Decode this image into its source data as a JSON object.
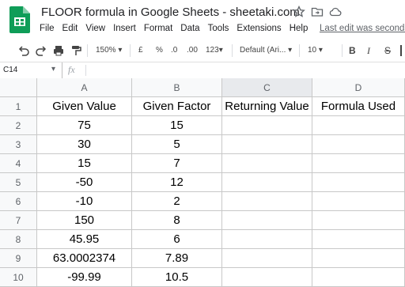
{
  "window": {
    "doc_title": "FLOOR formula in Google Sheets - sheetaki.com",
    "last_edit": "Last edit was seconds"
  },
  "menu": [
    "File",
    "Edit",
    "View",
    "Insert",
    "Format",
    "Data",
    "Tools",
    "Extensions",
    "Help"
  ],
  "toolbar": {
    "zoom": "150%",
    "currency": "£",
    "percent": "%",
    "dec_less": ".0",
    "dec_more": ".00",
    "more_formats": "123",
    "font": "Default (Ari...",
    "font_size": "10",
    "bold": "B",
    "italic": "I",
    "strike": "S"
  },
  "formula_bar": {
    "name_box": "C14",
    "fx": "fx",
    "value": ""
  },
  "sheet": {
    "columns": [
      "A",
      "B",
      "C",
      "D"
    ],
    "selected_column": "C",
    "rows": [
      {
        "n": "1",
        "cells": [
          "Given Value",
          "Given Factor",
          "Returning Value",
          "Formula Used"
        ]
      },
      {
        "n": "2",
        "cells": [
          "75",
          "15",
          "",
          ""
        ]
      },
      {
        "n": "3",
        "cells": [
          "30",
          "5",
          "",
          ""
        ]
      },
      {
        "n": "4",
        "cells": [
          "15",
          "7",
          "",
          ""
        ]
      },
      {
        "n": "5",
        "cells": [
          "-50",
          "12",
          "",
          ""
        ]
      },
      {
        "n": "6",
        "cells": [
          "-10",
          "2",
          "",
          ""
        ]
      },
      {
        "n": "7",
        "cells": [
          "150",
          "8",
          "",
          ""
        ]
      },
      {
        "n": "8",
        "cells": [
          "45.95",
          "6",
          "",
          ""
        ]
      },
      {
        "n": "9",
        "cells": [
          "63.0002374",
          "7.89",
          "",
          ""
        ]
      },
      {
        "n": "10",
        "cells": [
          "-99.99",
          "10.5",
          "",
          ""
        ]
      }
    ]
  },
  "colors": {
    "sheets_green": "#0f9d58",
    "header_bg": "#f8f9fa",
    "grid_line": "#c8c8c8"
  }
}
